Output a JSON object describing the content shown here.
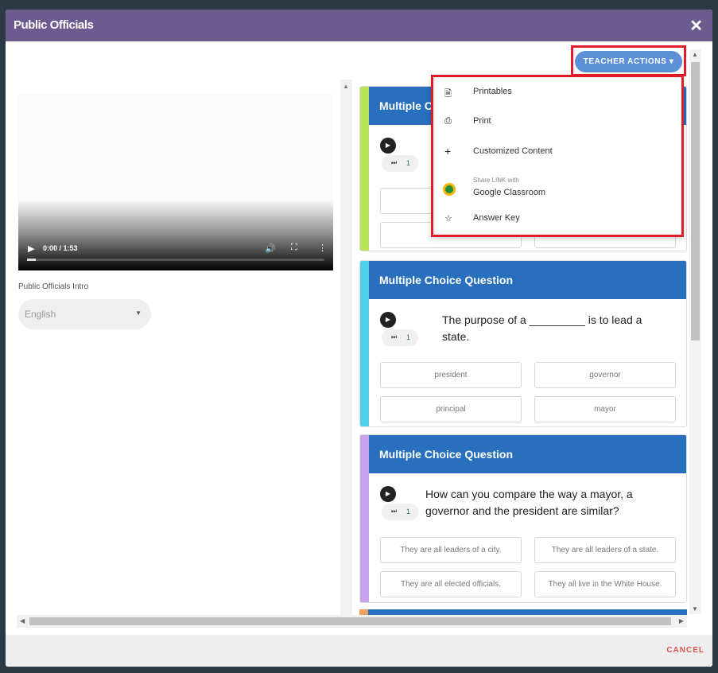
{
  "modal": {
    "title": "Public Officials",
    "close_symbol": "✕",
    "cancel_label": "CANCEL"
  },
  "teacher_actions": {
    "label": "TEACHER ACTIONS ▾",
    "menu": [
      {
        "icon": "document-icon",
        "label": "Printables"
      },
      {
        "icon": "printer-icon",
        "label": "Print"
      },
      {
        "icon": "plus-icon",
        "label": "Customized Content"
      },
      {
        "icon": "google-classroom-icon",
        "sublabel": "Share LINK with",
        "label": "Google Classroom"
      },
      {
        "icon": "star-icon",
        "label": "Answer Key"
      }
    ]
  },
  "video": {
    "time": "0:00 / 1:53",
    "progress": 0.03,
    "caption": "Public Officials Intro"
  },
  "language": {
    "selected": "English"
  },
  "questions": [
    {
      "header": "Multiple Choice Question",
      "stripe_color": "#b7e35a",
      "skip_count": "1",
      "text": "",
      "answers": []
    },
    {
      "header": "Multiple Choice Question",
      "stripe_color": "#4dd0e8",
      "skip_count": "1",
      "text": "The purpose of a _________ is to lead a state.",
      "answers": [
        "president",
        "governor",
        "principal",
        "mayor"
      ]
    },
    {
      "header": "Multiple Choice Question",
      "stripe_color": "#c7a3ee",
      "skip_count": "1",
      "text": "How can you compare the way a mayor, a governor and the president are similar?",
      "answers": [
        "They are all leaders of a city.",
        "They are all leaders of a state.",
        "They are all elected officials.",
        "They all live in the White House."
      ]
    }
  ]
}
